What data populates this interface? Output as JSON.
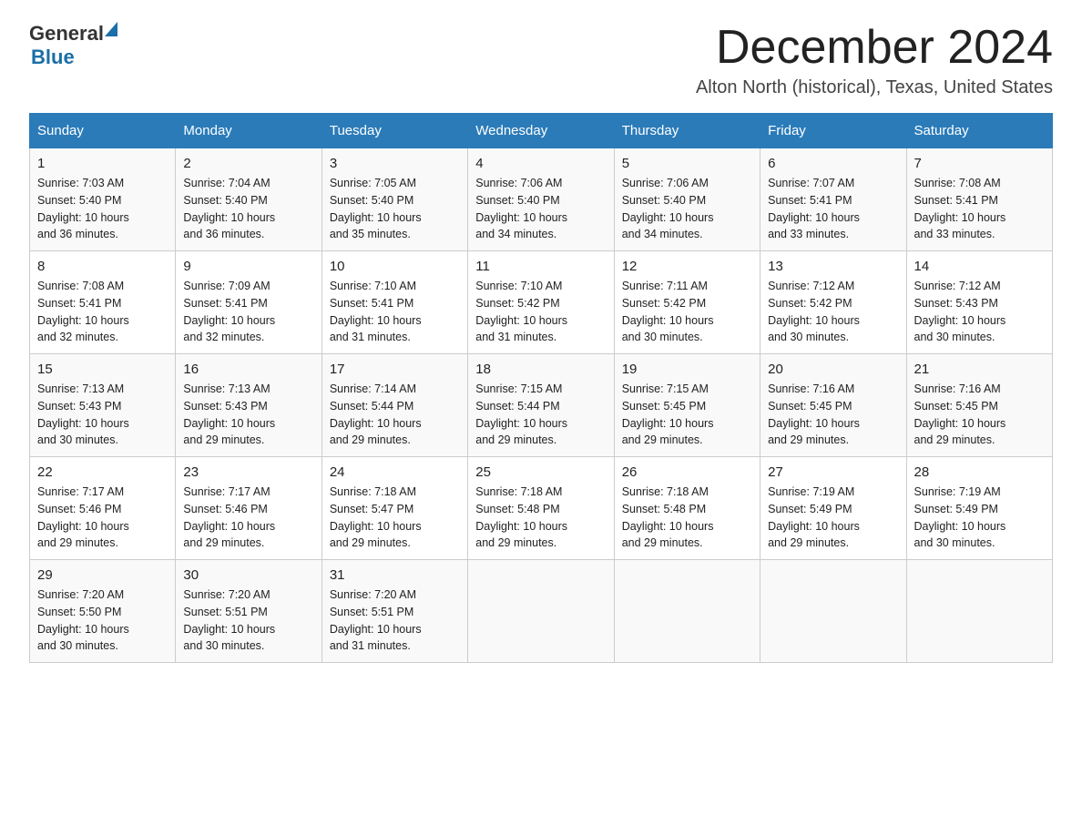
{
  "logo": {
    "text_general": "General",
    "text_blue": "Blue",
    "alt": "GeneralBlue logo"
  },
  "header": {
    "month_title": "December 2024",
    "location": "Alton North (historical), Texas, United States"
  },
  "days_of_week": [
    "Sunday",
    "Monday",
    "Tuesday",
    "Wednesday",
    "Thursday",
    "Friday",
    "Saturday"
  ],
  "weeks": [
    [
      {
        "day": "1",
        "sunrise": "7:03 AM",
        "sunset": "5:40 PM",
        "daylight": "10 hours and 36 minutes."
      },
      {
        "day": "2",
        "sunrise": "7:04 AM",
        "sunset": "5:40 PM",
        "daylight": "10 hours and 36 minutes."
      },
      {
        "day": "3",
        "sunrise": "7:05 AM",
        "sunset": "5:40 PM",
        "daylight": "10 hours and 35 minutes."
      },
      {
        "day": "4",
        "sunrise": "7:06 AM",
        "sunset": "5:40 PM",
        "daylight": "10 hours and 34 minutes."
      },
      {
        "day": "5",
        "sunrise": "7:06 AM",
        "sunset": "5:40 PM",
        "daylight": "10 hours and 34 minutes."
      },
      {
        "day": "6",
        "sunrise": "7:07 AM",
        "sunset": "5:41 PM",
        "daylight": "10 hours and 33 minutes."
      },
      {
        "day": "7",
        "sunrise": "7:08 AM",
        "sunset": "5:41 PM",
        "daylight": "10 hours and 33 minutes."
      }
    ],
    [
      {
        "day": "8",
        "sunrise": "7:08 AM",
        "sunset": "5:41 PM",
        "daylight": "10 hours and 32 minutes."
      },
      {
        "day": "9",
        "sunrise": "7:09 AM",
        "sunset": "5:41 PM",
        "daylight": "10 hours and 32 minutes."
      },
      {
        "day": "10",
        "sunrise": "7:10 AM",
        "sunset": "5:41 PM",
        "daylight": "10 hours and 31 minutes."
      },
      {
        "day": "11",
        "sunrise": "7:10 AM",
        "sunset": "5:42 PM",
        "daylight": "10 hours and 31 minutes."
      },
      {
        "day": "12",
        "sunrise": "7:11 AM",
        "sunset": "5:42 PM",
        "daylight": "10 hours and 30 minutes."
      },
      {
        "day": "13",
        "sunrise": "7:12 AM",
        "sunset": "5:42 PM",
        "daylight": "10 hours and 30 minutes."
      },
      {
        "day": "14",
        "sunrise": "7:12 AM",
        "sunset": "5:43 PM",
        "daylight": "10 hours and 30 minutes."
      }
    ],
    [
      {
        "day": "15",
        "sunrise": "7:13 AM",
        "sunset": "5:43 PM",
        "daylight": "10 hours and 30 minutes."
      },
      {
        "day": "16",
        "sunrise": "7:13 AM",
        "sunset": "5:43 PM",
        "daylight": "10 hours and 29 minutes."
      },
      {
        "day": "17",
        "sunrise": "7:14 AM",
        "sunset": "5:44 PM",
        "daylight": "10 hours and 29 minutes."
      },
      {
        "day": "18",
        "sunrise": "7:15 AM",
        "sunset": "5:44 PM",
        "daylight": "10 hours and 29 minutes."
      },
      {
        "day": "19",
        "sunrise": "7:15 AM",
        "sunset": "5:45 PM",
        "daylight": "10 hours and 29 minutes."
      },
      {
        "day": "20",
        "sunrise": "7:16 AM",
        "sunset": "5:45 PM",
        "daylight": "10 hours and 29 minutes."
      },
      {
        "day": "21",
        "sunrise": "7:16 AM",
        "sunset": "5:45 PM",
        "daylight": "10 hours and 29 minutes."
      }
    ],
    [
      {
        "day": "22",
        "sunrise": "7:17 AM",
        "sunset": "5:46 PM",
        "daylight": "10 hours and 29 minutes."
      },
      {
        "day": "23",
        "sunrise": "7:17 AM",
        "sunset": "5:46 PM",
        "daylight": "10 hours and 29 minutes."
      },
      {
        "day": "24",
        "sunrise": "7:18 AM",
        "sunset": "5:47 PM",
        "daylight": "10 hours and 29 minutes."
      },
      {
        "day": "25",
        "sunrise": "7:18 AM",
        "sunset": "5:48 PM",
        "daylight": "10 hours and 29 minutes."
      },
      {
        "day": "26",
        "sunrise": "7:18 AM",
        "sunset": "5:48 PM",
        "daylight": "10 hours and 29 minutes."
      },
      {
        "day": "27",
        "sunrise": "7:19 AM",
        "sunset": "5:49 PM",
        "daylight": "10 hours and 29 minutes."
      },
      {
        "day": "28",
        "sunrise": "7:19 AM",
        "sunset": "5:49 PM",
        "daylight": "10 hours and 30 minutes."
      }
    ],
    [
      {
        "day": "29",
        "sunrise": "7:20 AM",
        "sunset": "5:50 PM",
        "daylight": "10 hours and 30 minutes."
      },
      {
        "day": "30",
        "sunrise": "7:20 AM",
        "sunset": "5:51 PM",
        "daylight": "10 hours and 30 minutes."
      },
      {
        "day": "31",
        "sunrise": "7:20 AM",
        "sunset": "5:51 PM",
        "daylight": "10 hours and 31 minutes."
      },
      null,
      null,
      null,
      null
    ]
  ],
  "labels": {
    "sunrise": "Sunrise:",
    "sunset": "Sunset:",
    "daylight": "Daylight:"
  }
}
